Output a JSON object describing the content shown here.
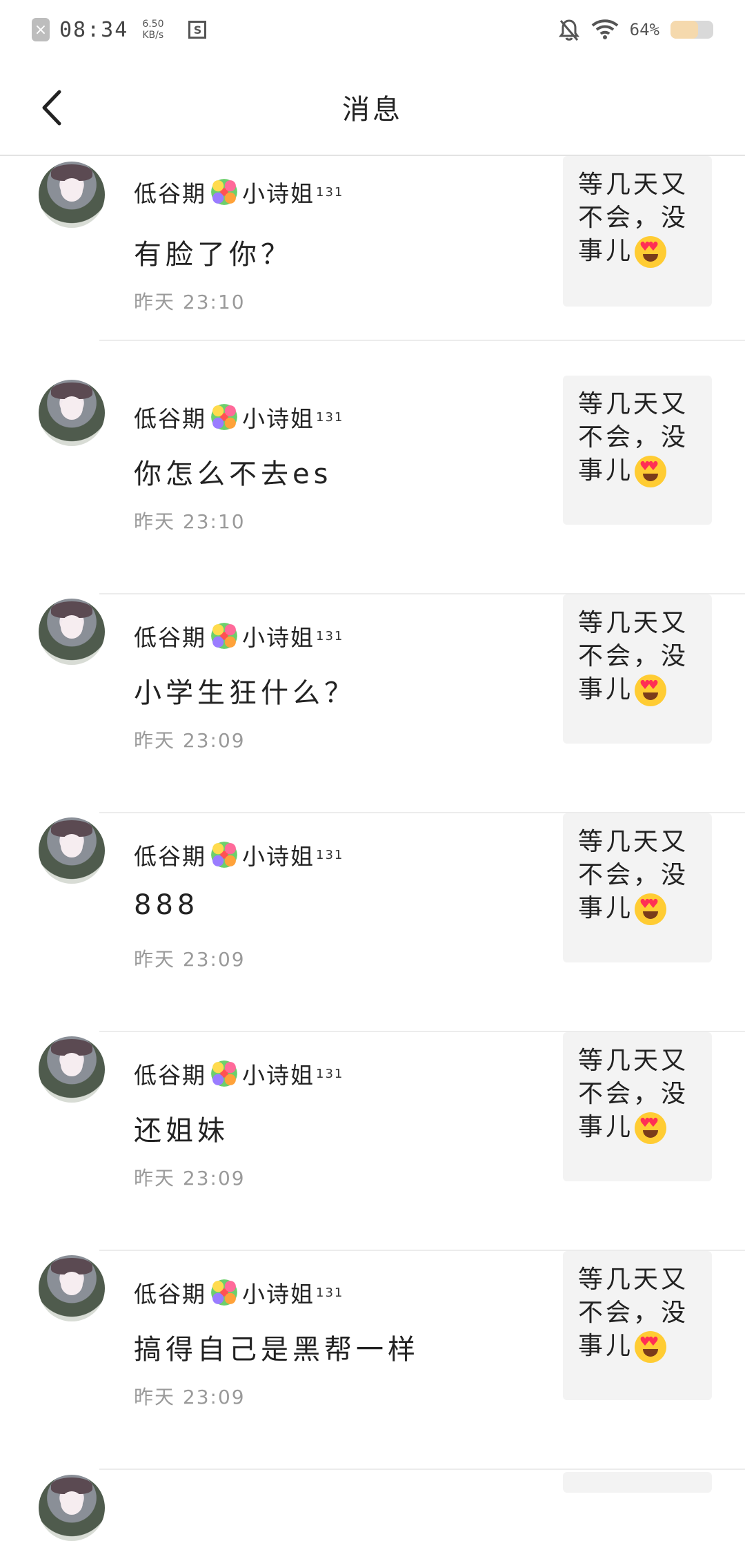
{
  "status_bar": {
    "time": "08:34",
    "speed_value": "6.50",
    "speed_unit": "KB/s",
    "battery_pct": "64%",
    "battery_level": 0.64,
    "icons": [
      "close-icon",
      "screenshot-icon",
      "mute-bell-icon",
      "wifi-icon",
      "battery-icon"
    ]
  },
  "header": {
    "title": "消息",
    "back_icon": "chevron-left-icon"
  },
  "messages": [
    {
      "name_left": "低谷期",
      "name_right": "小诗姐",
      "level": "131",
      "text": "有脸了你？",
      "time": "昨天 23:10",
      "thumb_text": "等几天又不会，没事儿"
    },
    {
      "name_left": "低谷期",
      "name_right": "小诗姐",
      "level": "131",
      "text": "你怎么不去es",
      "time": "昨天 23:10",
      "thumb_text": "等几天又不会，没事儿"
    },
    {
      "name_left": "低谷期",
      "name_right": "小诗姐",
      "level": "131",
      "text": "小学生狂什么？",
      "time": "昨天 23:09",
      "thumb_text": "等几天又不会，没事儿"
    },
    {
      "name_left": "低谷期",
      "name_right": "小诗姐",
      "level": "131",
      "text": "888",
      "time": "昨天 23:09",
      "thumb_text": "等几天又不会，没事儿"
    },
    {
      "name_left": "低谷期",
      "name_right": "小诗姐",
      "level": "131",
      "text": "还姐妹",
      "time": "昨天 23:09",
      "thumb_text": "等几天又不会，没事儿"
    },
    {
      "name_left": "低谷期",
      "name_right": "小诗姐",
      "level": "131",
      "text": "搞得自己是黑帮一样",
      "time": "昨天 23:09",
      "thumb_text": "等几天又不会，没事儿"
    }
  ]
}
